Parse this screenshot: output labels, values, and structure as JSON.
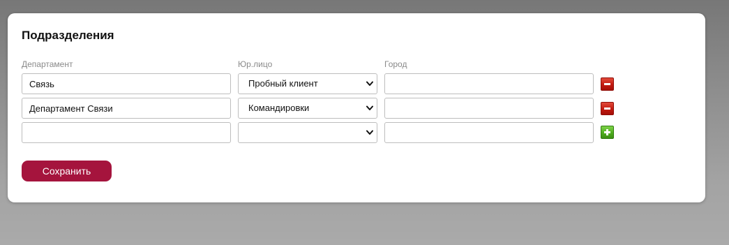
{
  "panel": {
    "title": "Подразделения"
  },
  "columns": {
    "department": "Департамент",
    "legal_entity": "Юр.лицо",
    "city": "Город"
  },
  "rows": [
    {
      "department": "Связь",
      "legal_entity": "Пробный клиент",
      "city": "",
      "action": "remove",
      "action_icon": "minus-icon"
    },
    {
      "department": "Департамент Связи",
      "legal_entity": "Командировки",
      "city": "",
      "action": "remove",
      "action_icon": "minus-icon"
    },
    {
      "department": "",
      "legal_entity": "",
      "city": "",
      "action": "add",
      "action_icon": "plus-icon"
    }
  ],
  "save_button": {
    "label": "Сохранить"
  },
  "colors": {
    "accent": "#a5143d",
    "remove": "#c21a10",
    "add": "#4fae1f"
  }
}
